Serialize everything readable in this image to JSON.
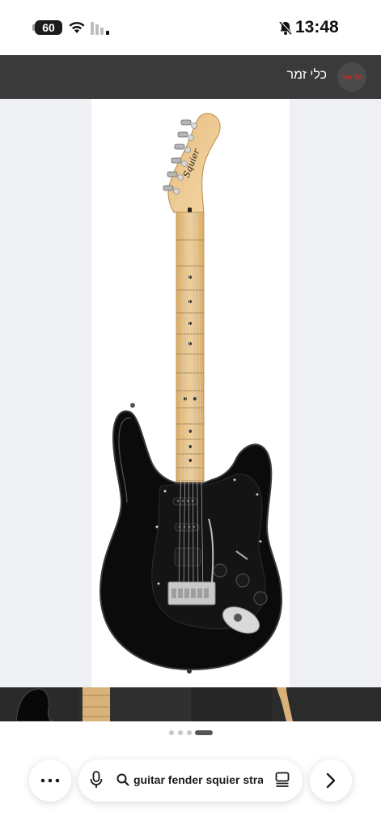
{
  "status_bar": {
    "battery": "60",
    "time": "13:48"
  },
  "header": {
    "title": "כלי זמר",
    "logo_text": "כלי זמר"
  },
  "product_image": {
    "alt": "Squier stratocaster black guitar",
    "brand_headstock": "Squier"
  },
  "carousel": {
    "total": 4,
    "active_index": 3
  },
  "toolbar": {
    "address_text": "guitar fender squier strat",
    "icons": [
      "more-icon",
      "microphone-icon",
      "search-icon",
      "tabs-icon",
      "forward-icon"
    ]
  },
  "colors": {
    "header_bg": "#3a3a3a",
    "image_bg": "#eef0f3",
    "guitar_body": "#0b0b0b",
    "neck": "#e9c58c"
  }
}
